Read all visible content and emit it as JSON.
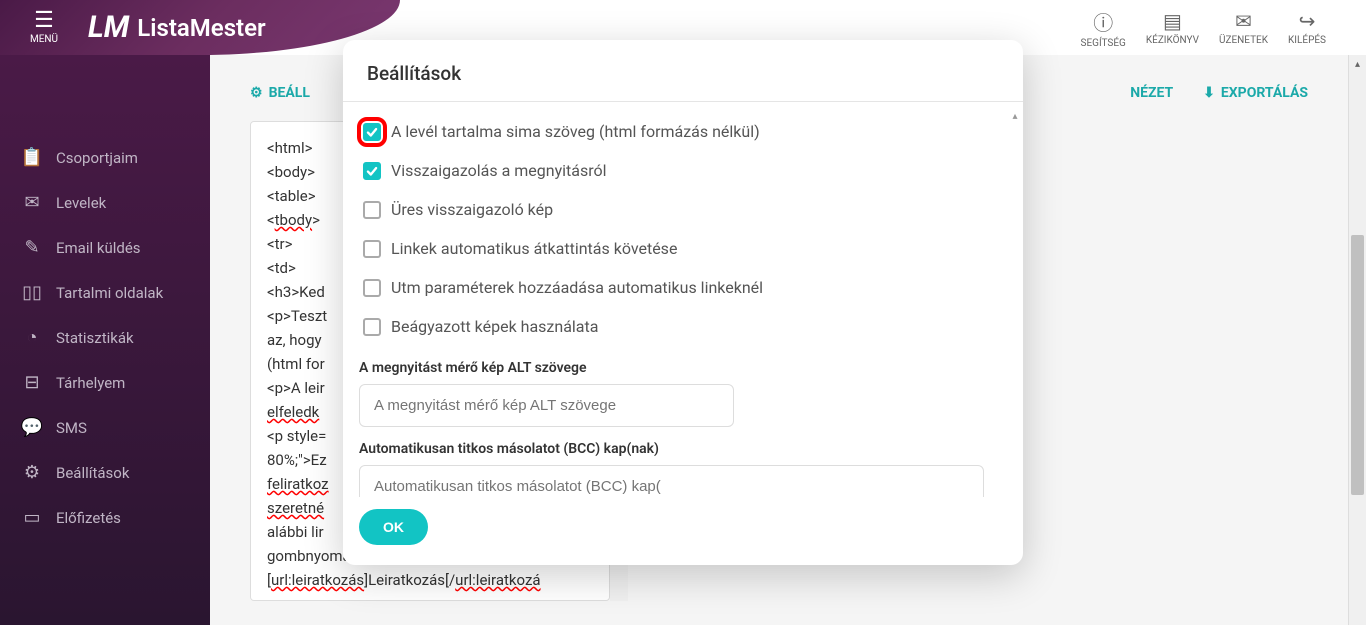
{
  "header": {
    "menu_label": "MENÜ",
    "logo_text": "ListaMester",
    "actions": [
      {
        "label": "SEGÍTSÉG",
        "icon": "help"
      },
      {
        "label": "KÉZIKÖNYV",
        "icon": "book"
      },
      {
        "label": "ÜZENETEK",
        "icon": "mail"
      },
      {
        "label": "KILÉPÉS",
        "icon": "exit"
      }
    ]
  },
  "sidebar": {
    "items": [
      {
        "label": "Csoportjaim",
        "icon": "clipboard"
      },
      {
        "label": "Levelek",
        "icon": "envelope"
      },
      {
        "label": "Email küldés",
        "icon": "pencil"
      },
      {
        "label": "Tartalmi oldalak",
        "icon": "pages"
      },
      {
        "label": "Statisztikák",
        "icon": "chart"
      },
      {
        "label": "Tárhelyem",
        "icon": "storage"
      },
      {
        "label": "SMS",
        "icon": "chat"
      },
      {
        "label": "Beállítások",
        "icon": "gear"
      },
      {
        "label": "Előfizetés",
        "icon": "card"
      }
    ]
  },
  "toolbar": {
    "settings": "BEÁLL",
    "preview": "NÉZET",
    "export": "EXPORTÁLÁS"
  },
  "editor": {
    "lines": [
      "<html>",
      "  <body>",
      "<table>",
      "<tbody>",
      "<tr>",
      "<td>",
      "<h3>Ked",
      "<p>Teszt",
      "az, hogy",
      "(html for",
      "<p>A leir",
      "elfeledk",
      "<p style=",
      "80%;\">Ez",
      "feliratkoz",
      "szeretné",
      "alábbi lir",
      "gombnyomással törlünk az adatbázisból:",
      "[url:leiratkozás]Leiratkozás[/url:leiratkozá"
    ]
  },
  "modal": {
    "title": "Beállítások",
    "checkboxes": [
      {
        "label": "A levél tartalma sima szöveg (html formázás nélkül)",
        "checked": true,
        "highlighted": true
      },
      {
        "label": "Visszaigazolás a megnyitásról",
        "checked": true,
        "highlighted": false
      },
      {
        "label": "Üres visszaigazoló kép",
        "checked": false,
        "highlighted": false
      },
      {
        "label": "Linkek automatikus átkattintás követése",
        "checked": false,
        "highlighted": false
      },
      {
        "label": "Utm paraméterek hozzáadása automatikus linkeknél",
        "checked": false,
        "highlighted": false
      },
      {
        "label": "Beágyazott képek használata",
        "checked": false,
        "highlighted": false
      }
    ],
    "alt_label": "A megnyitást mérő kép ALT szövege",
    "alt_placeholder": "A megnyitást mérő kép ALT szövege",
    "bcc_label": "Automatikusan titkos másolatot (BCC) kap(nak)",
    "bcc_placeholder": "Automatikusan titkos másolatot (BCC) kap(",
    "ok": "OK"
  }
}
